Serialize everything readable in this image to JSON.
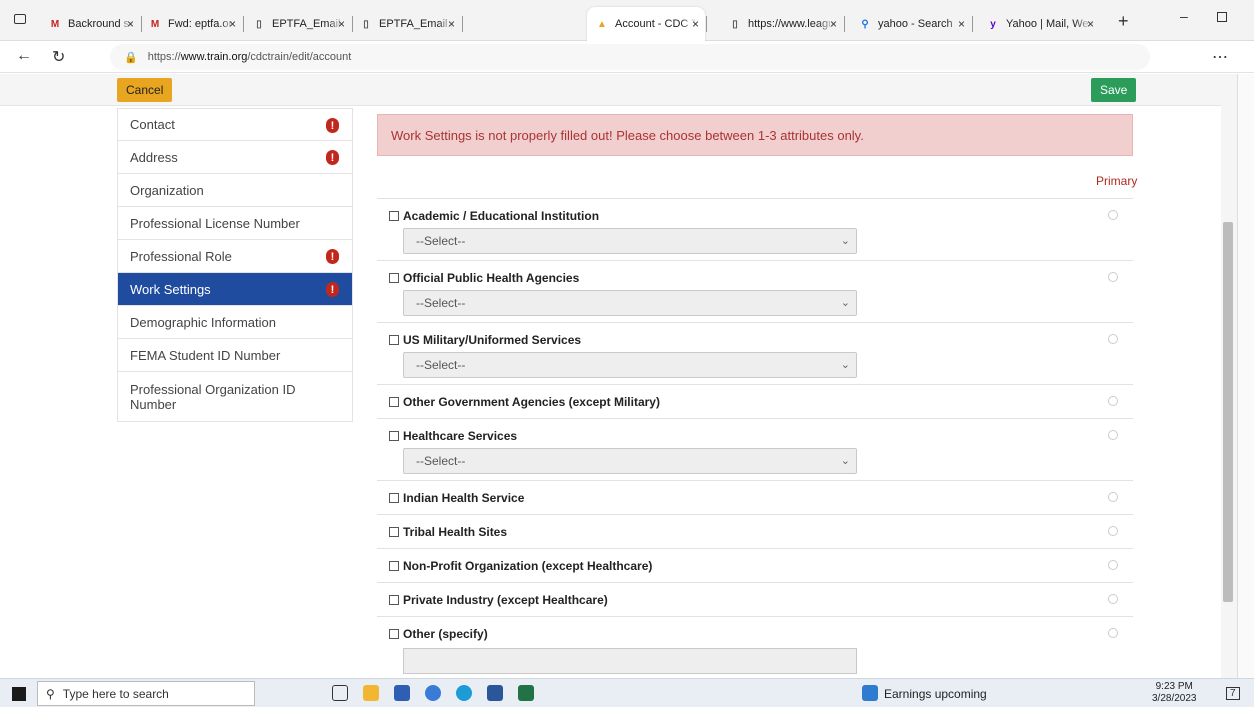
{
  "tabs": [
    {
      "label": "Backround screen",
      "fav": "gmail-icon"
    },
    {
      "label": "Fwd: eptfa.org -",
      "fav": "gmail-icon"
    },
    {
      "label": "EPTFA_Email.pdf",
      "fav": "document-icon"
    },
    {
      "label": "EPTFA_Email.pdf",
      "fav": "document-icon"
    },
    {
      "label": "Account - CDC TR",
      "fav": "cdc-train-icon"
    },
    {
      "label": "https://www.leagu",
      "fav": "document-icon"
    },
    {
      "label": "yahoo - Search",
      "fav": "search-icon"
    },
    {
      "label": "Yahoo | Mail, Wea",
      "fav": "yahoo-icon"
    }
  ],
  "address": {
    "prefix": "https://",
    "host": "www.train.org",
    "path": "/cdctrain/edit/account"
  },
  "actions": {
    "cancel": "Cancel",
    "save": "Save"
  },
  "sidebar": [
    {
      "label": "Contact",
      "warn": true
    },
    {
      "label": "Address",
      "warn": true
    },
    {
      "label": "Organization",
      "warn": false
    },
    {
      "label": "Professional License Number",
      "warn": false
    },
    {
      "label": "Professional Role",
      "warn": true
    },
    {
      "label": "Work Settings",
      "warn": true,
      "active": true
    },
    {
      "label": "Demographic Information",
      "warn": false
    },
    {
      "label": "FEMA Student ID Number",
      "warn": false
    },
    {
      "label": "Professional Organization ID Number",
      "warn": false
    }
  ],
  "alert": "Work Settings is not properly filled out! Please choose between 1-3 attributes only.",
  "primary_label": "Primary",
  "settings": [
    {
      "label": "Academic / Educational Institution",
      "select": "--Select--"
    },
    {
      "label": "Official Public Health Agencies",
      "select": "--Select--"
    },
    {
      "label": "US Military/Uniformed Services",
      "select": "--Select--"
    },
    {
      "label": "Other Government Agencies (except Military)"
    },
    {
      "label": "Healthcare Services",
      "select": "--Select--"
    },
    {
      "label": "Indian Health Service"
    },
    {
      "label": "Tribal Health Sites"
    },
    {
      "label": "Non-Profit Organization (except Healthcare)"
    },
    {
      "label": "Private Industry (except Healthcare)"
    },
    {
      "label": "Other (specify)",
      "textbox": true
    }
  ],
  "taskbar": {
    "search_placeholder": "Type here to search",
    "news": "Earnings upcoming",
    "time": "9:23 PM",
    "date": "3/28/2023",
    "notifications": "7"
  },
  "colors": {
    "accent_blue": "#1f4c9f",
    "warn_red": "#c1271d",
    "save_green": "#2b9c5a",
    "cancel_amber": "#e7a520",
    "alert_bg": "#f2cfcf"
  }
}
